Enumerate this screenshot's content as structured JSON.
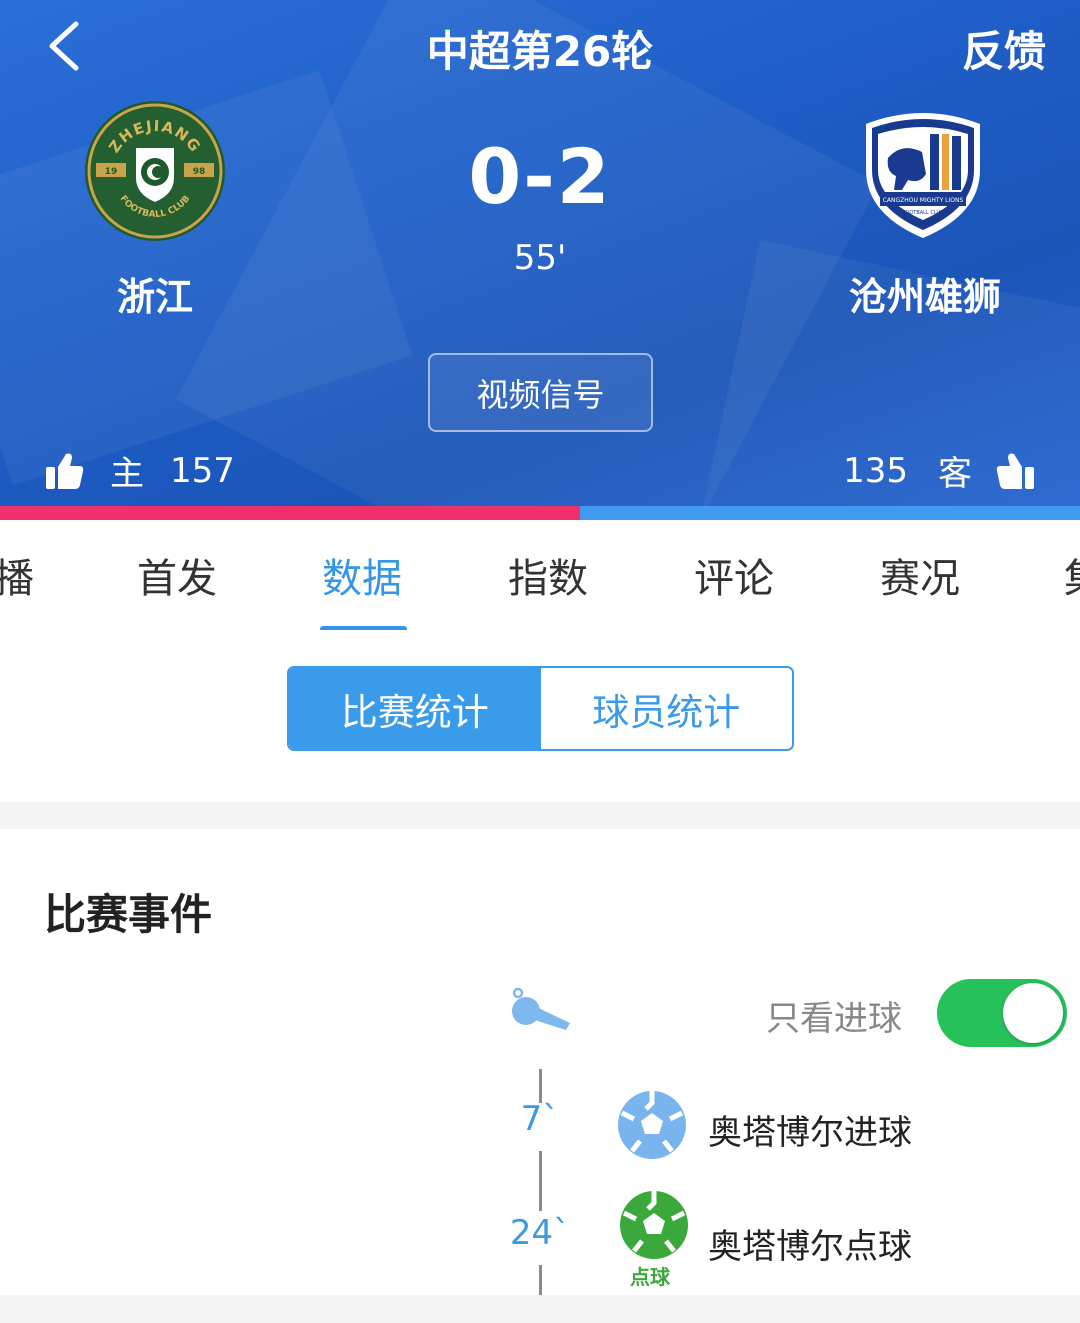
{
  "header": {
    "title": "中超第26轮",
    "feedback_label": "反馈",
    "home_team": "浙江",
    "away_team": "沧州雄狮",
    "score": "0-2",
    "minute": "55'",
    "video_button": "视频信号",
    "home_label": "主",
    "away_label": "客",
    "home_likes": "157",
    "away_likes": "135",
    "home_like_share": 0.537,
    "home_logo": {
      "top_text": "ZHEJIANG",
      "year_left": "19",
      "year_right": "98",
      "bottom_text": "FOOTBALL CLUB"
    },
    "away_logo": {
      "text_1": "CANGZHOU MIGHTY LIONS",
      "text_2": "FOOTBALL CLUB"
    }
  },
  "tabs": [
    "播",
    "首发",
    "数据",
    "指数",
    "评论",
    "赛况",
    "集"
  ],
  "active_tab": "数据",
  "segment": {
    "match_stats": "比赛统计",
    "player_stats": "球员统计"
  },
  "events": {
    "title": "比赛事件",
    "goals_only_label": "只看进球",
    "goals_only_on": true,
    "items": [
      {
        "minute": "7`",
        "text": "奥塔博尔进球",
        "type": "goal"
      },
      {
        "minute": "24`",
        "text": "奥塔博尔点球",
        "type": "penalty",
        "tag": "点球"
      }
    ]
  },
  "colors": {
    "accent": "#3595e8",
    "home_bar": "#f0306d",
    "away_bar": "#3f9af0",
    "toggle_on": "#27c15a",
    "header_blue": "#1f5fc8"
  }
}
